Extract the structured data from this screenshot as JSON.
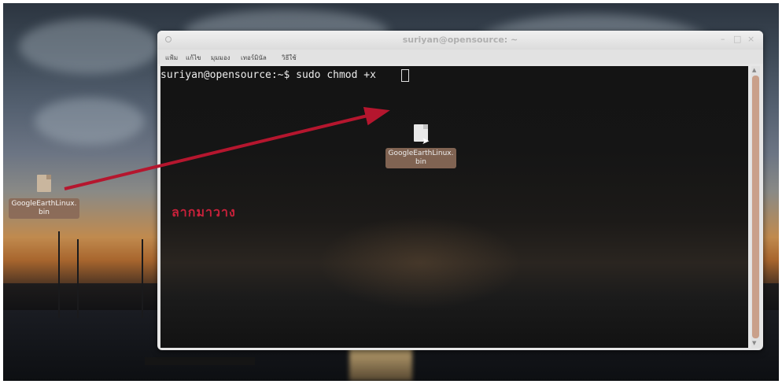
{
  "window": {
    "title": "suriyan@opensource: ~",
    "minimize": "–",
    "maximize": "□",
    "close": "×"
  },
  "menubar": {
    "items": [
      "แฟ้ม",
      "แก้ไข",
      "มุมมอง",
      "เทอร์มินัล",
      "วิธีใช้"
    ]
  },
  "terminal": {
    "prompt": "suriyan@opensource:~$ sudo chmod +x "
  },
  "desktop_file": {
    "label": "GoogleEarthLinux.bin"
  },
  "dropped_file": {
    "label": "GoogleEarthLinux.bin"
  },
  "annotation": {
    "text": "ลากมาวาง",
    "color": "#c8213a"
  },
  "icons": [
    "file-icon",
    "mouse-pointer-icon",
    "drag-arrow"
  ]
}
